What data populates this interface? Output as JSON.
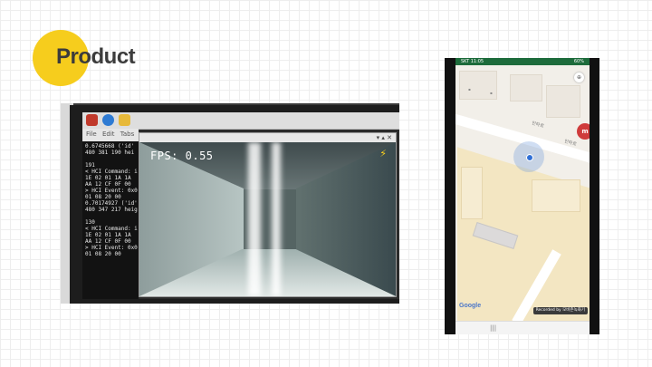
{
  "title": "Product",
  "left_photo": {
    "camera_overlay": {
      "fps_text": "FPS: 0.55"
    },
    "terminal": {
      "menu": [
        "File",
        "Edit",
        "Tabs"
      ],
      "lines": [
        "0.6745668 ('id'",
        "480 381 190 hei",
        "",
        "191",
        "< HCI Command: i",
        "  1E 02 01 1A 1A",
        "  AA 12 CF 0F 00",
        "> HCI Event: 0x0",
        "  01 08 20 00",
        "0.70174927 ('id'",
        "480 347 217 heig",
        "",
        "130",
        "< HCI Command: i",
        "  1E 02 01 1A 1A",
        "  AA 12 CF 0F 00",
        "> HCI Event: 0x0",
        "  01 08 20 00"
      ]
    }
  },
  "right_phone": {
    "status_left": "SKT 11:05",
    "status_right": "60%",
    "road_labels": [
      "인하로",
      "인하로"
    ],
    "google": "Google",
    "recorded_by": "Recorded by 모비즌녹화기"
  },
  "colors": {
    "title_dot": "#f6cd1d",
    "statusbar": "#1d6b3b",
    "location": "#2f6fd6"
  }
}
